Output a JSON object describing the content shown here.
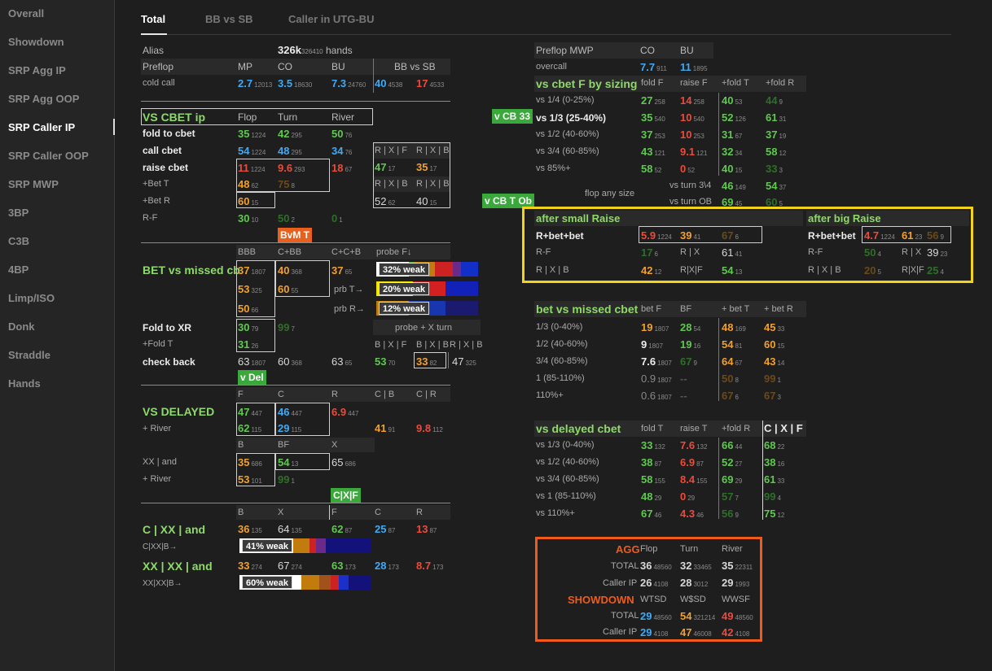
{
  "sidebar": {
    "items": [
      "Overall",
      "Showdown",
      "SRP Agg IP",
      "SRP Agg OOP",
      "SRP Caller IP",
      "SRP Caller OOP",
      "SRP MWP",
      "3BP",
      "C3B",
      "4BP",
      "Limp/ISO",
      "Donk",
      "Straddle",
      "Hands"
    ]
  },
  "tabs": [
    "Total",
    "BB vs SB",
    "Caller in UTG-BU"
  ],
  "alias": {
    "label": "Alias",
    "hands_main": "326k",
    "hands_sub": "326410",
    "hands_word": "hands"
  },
  "preflop": {
    "label": "Preflop",
    "cols": [
      "MP",
      "CO",
      "BU",
      "BB vs SB"
    ],
    "row_label": "cold call",
    "vals": [
      [
        "2.7",
        "12013"
      ],
      [
        "3.5",
        "18630"
      ],
      [
        "7.3",
        "24760"
      ],
      [
        "40",
        "4538"
      ],
      [
        "17",
        "4533"
      ]
    ]
  },
  "cbet_ip": {
    "title": "VS CBET ip",
    "cols": [
      "Flop",
      "Turn",
      "River"
    ],
    "rows": [
      {
        "label": "fold to cbet",
        "v": [
          [
            "35",
            "1224"
          ],
          [
            "42",
            "295"
          ],
          [
            "50",
            "76"
          ]
        ]
      },
      {
        "label": "call cbet",
        "v": [
          [
            "54",
            "1224"
          ],
          [
            "48",
            "295"
          ],
          [
            "34",
            "76"
          ]
        ]
      },
      {
        "label": "raise cbet",
        "v": [
          [
            "11",
            "1224"
          ],
          [
            "9.6",
            "293"
          ],
          [
            "18",
            "67"
          ]
        ]
      },
      {
        "label": "+Bet T",
        "v": [
          [
            "48",
            "62"
          ],
          [
            "75",
            "8"
          ]
        ]
      },
      {
        "label": "+Bet R",
        "v": [
          [
            "60",
            "15"
          ]
        ]
      },
      {
        "label": "R-F",
        "v": [
          [
            "30",
            "10"
          ],
          [
            "50",
            "2"
          ],
          [
            "0",
            "1"
          ]
        ]
      }
    ],
    "side_cols": [
      "R | X | F",
      "R | X | B",
      "R | X | B",
      "R | X | B"
    ],
    "side_vals": [
      [
        "47",
        "17"
      ],
      [
        "35",
        "17"
      ],
      [
        "52",
        "62"
      ],
      [
        "40",
        "15"
      ]
    ]
  },
  "tags": {
    "bvm_t": "BvM T",
    "v_del": "v Del",
    "cxf": "C|X|F",
    "v_cb33": "v CB 33",
    "v_cbt_ob": "v CB T Ob"
  },
  "bet_missed": {
    "title": "BET vs missed cb",
    "cols": [
      "BBB",
      "C+BB",
      "C+C+B",
      "probe F↓"
    ],
    "vals": [
      [
        "37",
        "1807"
      ],
      [
        "40",
        "368"
      ],
      [
        "37",
        "65"
      ],
      [
        "53",
        "325"
      ],
      [
        "60",
        "55"
      ],
      [
        "50",
        "66"
      ]
    ],
    "prb_labels": [
      "prb T→",
      "prb R→"
    ],
    "bars": [
      {
        "label": "32% weak"
      },
      {
        "label": "20% weak"
      },
      {
        "label": "12% weak"
      }
    ]
  },
  "fold_xr": {
    "label": "Fold to XR",
    "plus_label": "+Fold T",
    "check_label": "check back",
    "vals": [
      [
        "30",
        "79"
      ],
      [
        "99",
        "7"
      ],
      [
        "31",
        "26"
      ]
    ],
    "check_vals": [
      [
        "63",
        "1807"
      ],
      [
        "60",
        "368"
      ],
      [
        "63",
        "65"
      ]
    ],
    "probe_title": "probe + X turn",
    "probe_cols": [
      "B | X | F",
      "B | X | B",
      "R | X | B"
    ],
    "probe_vals": [
      [
        "53",
        "70"
      ],
      [
        "33",
        "82"
      ],
      [
        "47",
        "325"
      ]
    ]
  },
  "delayed": {
    "title": "VS DELAYED",
    "river_label": "+ River",
    "cols": [
      "F",
      "C",
      "R",
      "C | B",
      "C | R"
    ],
    "row1": [
      [
        "47",
        "447"
      ],
      [
        "46",
        "447"
      ],
      [
        "6.9",
        "447"
      ]
    ],
    "row2": [
      [
        "62",
        "115"
      ],
      [
        "29",
        "115"
      ],
      [
        "41",
        "91"
      ],
      [
        "9.8",
        "112"
      ]
    ],
    "cols2": [
      "B",
      "BF",
      "X"
    ],
    "xx_label": "XX | and",
    "river2_label": "+ River",
    "row3": [
      [
        "35",
        "686"
      ],
      [
        "54",
        "13"
      ],
      [
        "65",
        "686"
      ]
    ],
    "row4": [
      [
        "53",
        "101"
      ],
      [
        "99",
        "1"
      ]
    ]
  },
  "cxx": {
    "cols": [
      "B",
      "X",
      "F",
      "C",
      "R"
    ],
    "row1_title": "C | XX | and",
    "row1": [
      [
        "36",
        "135"
      ],
      [
        "64",
        "135"
      ],
      [
        "62",
        "87"
      ],
      [
        "25",
        "87"
      ],
      [
        "13",
        "87"
      ]
    ],
    "row1_sub": "C|XX|B→",
    "bar1": "41% weak",
    "row2_title": "XX | XX | and",
    "row2": [
      [
        "33",
        "274"
      ],
      [
        "67",
        "274"
      ],
      [
        "63",
        "173"
      ],
      [
        "28",
        "173"
      ],
      [
        "8.7",
        "173"
      ]
    ],
    "row2_sub": "XX|XX|B→",
    "bar2": "60% weak"
  },
  "mwp": {
    "title": "Preflop MWP",
    "cols": [
      "CO",
      "BU"
    ],
    "row_label": "overcall",
    "vals": [
      [
        "7.7",
        "911"
      ],
      [
        "11",
        "1895"
      ]
    ]
  },
  "cbet_sizing": {
    "title": "vs cbet F by sizing",
    "cols": [
      "fold F",
      "raise F",
      "+fold T",
      "+fold R"
    ],
    "rows": [
      {
        "label": "vs 1/4 (0-25%)",
        "v": [
          [
            "27",
            "258"
          ],
          [
            "14",
            "258"
          ],
          [
            "40",
            "53"
          ],
          [
            "44",
            "9"
          ]
        ]
      },
      {
        "label": "vs 1/3 (25-40%)",
        "v": [
          [
            "35",
            "540"
          ],
          [
            "10",
            "540"
          ],
          [
            "52",
            "126"
          ],
          [
            "61",
            "31"
          ]
        ]
      },
      {
        "label": "vs 1/2 (40-60%)",
        "v": [
          [
            "37",
            "253"
          ],
          [
            "10",
            "253"
          ],
          [
            "31",
            "67"
          ],
          [
            "37",
            "19"
          ]
        ]
      },
      {
        "label": "vs 3/4 (60-85%)",
        "v": [
          [
            "43",
            "121"
          ],
          [
            "9.1",
            "121"
          ],
          [
            "32",
            "34"
          ],
          [
            "58",
            "12"
          ]
        ]
      },
      {
        "label": "vs 85%+",
        "v": [
          [
            "58",
            "52"
          ],
          [
            "0",
            "52"
          ],
          [
            "40",
            "15"
          ],
          [
            "33",
            "3"
          ]
        ]
      }
    ],
    "turn1": "vs turn 3\\4",
    "turn1_v": [
      [
        "46",
        "149"
      ],
      [
        "54",
        "37"
      ]
    ],
    "flop_any": "flop any size",
    "turn2": "vs turn OB",
    "turn2_v": [
      [
        "69",
        "45"
      ],
      [
        "60",
        "5"
      ]
    ]
  },
  "raise": {
    "small_title": "after small Raise",
    "big_title": "after big Raise",
    "r1_label": "R+bet+bet",
    "r2_label": "R-F",
    "r3_label": "R | X | B",
    "small_r1": [
      [
        "5.9",
        "1224"
      ],
      [
        "39",
        "41"
      ],
      [
        "67",
        "6"
      ]
    ],
    "small_r2": [
      [
        "17",
        "6"
      ]
    ],
    "small_rx": "R | X",
    "small_rx_v": [
      "61",
      "41"
    ],
    "small_r3": [
      [
        "42",
        "12"
      ]
    ],
    "small_rxf": "R|X|F",
    "small_rxf_v": [
      "54",
      "13"
    ],
    "big_r1": [
      [
        "4.7",
        "1224"
      ],
      [
        "61",
        "23"
      ],
      [
        "56",
        "9"
      ]
    ],
    "big_r2": [
      [
        "50",
        "4"
      ]
    ],
    "big_rx": "R | X",
    "big_rx_v": [
      "39",
      "23"
    ],
    "big_r3": [
      [
        "20",
        "5"
      ]
    ],
    "big_rxf": "R|X|F",
    "big_rxf_v": [
      "25",
      "4"
    ]
  },
  "bet_missed_r": {
    "title": "bet vs missed cbet",
    "cols": [
      "bet F",
      "BF",
      "+ bet T",
      "+ bet R"
    ],
    "rows": [
      {
        "label": "1/3 (0-40%)",
        "v": [
          [
            "19",
            "1807"
          ],
          [
            "28",
            "54"
          ],
          [
            "48",
            "169"
          ],
          [
            "45",
            "33"
          ]
        ]
      },
      {
        "label": "1/2 (40-60%)",
        "v": [
          [
            "9",
            "1807"
          ],
          [
            "19",
            "16"
          ],
          [
            "54",
            "81"
          ],
          [
            "60",
            "15"
          ]
        ]
      },
      {
        "label": "3/4 (60-85%)",
        "v": [
          [
            "7.6",
            "1807"
          ],
          [
            "67",
            "9"
          ],
          [
            "64",
            "67"
          ],
          [
            "43",
            "14"
          ]
        ]
      },
      {
        "label": "1 (85-110%)",
        "v": [
          [
            "0.9",
            "1807"
          ],
          [
            "--",
            ""
          ],
          [
            "50",
            "8"
          ],
          [
            "99",
            "1"
          ]
        ]
      },
      {
        "label": "110%+",
        "v": [
          [
            "0.6",
            "1807"
          ],
          [
            "--",
            ""
          ],
          [
            "67",
            "6"
          ],
          [
            "67",
            "3"
          ]
        ]
      }
    ]
  },
  "delayed_cbet": {
    "title": "vs delayed cbet",
    "cols": [
      "fold T",
      "raise T",
      "+fold R",
      "C | X | F"
    ],
    "rows": [
      {
        "label": "vs 1/3 (0-40%)",
        "v": [
          [
            "33",
            "132"
          ],
          [
            "7.6",
            "132"
          ],
          [
            "66",
            "44"
          ],
          [
            "68",
            "22"
          ]
        ]
      },
      {
        "label": "vs 1/2 (40-60%)",
        "v": [
          [
            "38",
            "87"
          ],
          [
            "6.9",
            "87"
          ],
          [
            "52",
            "27"
          ],
          [
            "38",
            "16"
          ]
        ]
      },
      {
        "label": "vs 3/4 (60-85%)",
        "v": [
          [
            "58",
            "155"
          ],
          [
            "8.4",
            "155"
          ],
          [
            "69",
            "29"
          ],
          [
            "61",
            "33"
          ]
        ]
      },
      {
        "label": "vs 1 (85-110%)",
        "v": [
          [
            "48",
            "29"
          ],
          [
            "0",
            "29"
          ],
          [
            "57",
            "7"
          ],
          [
            "99",
            "4"
          ]
        ]
      },
      {
        "label": "vs 110%+",
        "v": [
          [
            "67",
            "46"
          ],
          [
            "4.3",
            "46"
          ],
          [
            "56",
            "9"
          ],
          [
            "75",
            "12"
          ]
        ]
      }
    ]
  },
  "agg": {
    "title": "AGG",
    "cols": [
      "Flop",
      "Turn",
      "River"
    ],
    "rows": [
      {
        "label": "TOTAL",
        "v": [
          [
            "36",
            "48560"
          ],
          [
            "32",
            "33465"
          ],
          [
            "35",
            "22311"
          ]
        ]
      },
      {
        "label": "Caller IP",
        "v": [
          [
            "26",
            "4108"
          ],
          [
            "28",
            "3012"
          ],
          [
            "29",
            "1993"
          ]
        ]
      }
    ],
    "sd_title": "SHOWDOWN",
    "sd_cols": [
      "WTSD",
      "W$SD",
      "WWSF"
    ],
    "sd_rows": [
      {
        "label": "TOTAL",
        "v": [
          [
            "29",
            "48560"
          ],
          [
            "54",
            "321214"
          ],
          [
            "49",
            "48560"
          ]
        ]
      },
      {
        "label": "Caller IP",
        "v": [
          [
            "29",
            "4108"
          ],
          [
            "47",
            "46008"
          ],
          [
            "42",
            "4108"
          ]
        ]
      }
    ]
  }
}
